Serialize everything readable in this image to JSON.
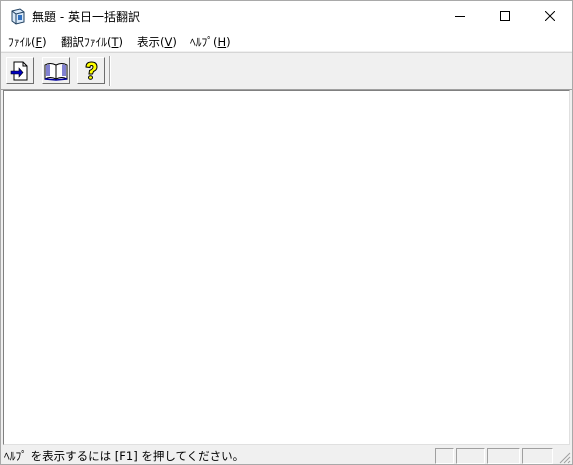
{
  "window": {
    "title": "無題 - 英日一括翻訳"
  },
  "menu": {
    "items": [
      {
        "label": "ﾌｧｲﾙ(",
        "accel": "F",
        "suffix": ")"
      },
      {
        "label": "翻訳ﾌｧｲﾙ(",
        "accel": "T",
        "suffix": ")"
      },
      {
        "label": "表示(",
        "accel": "V",
        "suffix": ")"
      },
      {
        "label": "ﾍﾙﾌﾟ(",
        "accel": "H",
        "suffix": ")"
      }
    ]
  },
  "toolbar": {
    "buttons": [
      {
        "icon": "open-file-icon"
      },
      {
        "icon": "dictionary-book-icon"
      },
      {
        "icon": "help-question-icon"
      }
    ]
  },
  "status": {
    "text": "ﾍﾙﾌﾟ を表示するには [F1] を押してください。"
  },
  "colors": {
    "face": "#f0f0f0",
    "client": "#ffffff",
    "help_yellow": "#ffff00"
  }
}
